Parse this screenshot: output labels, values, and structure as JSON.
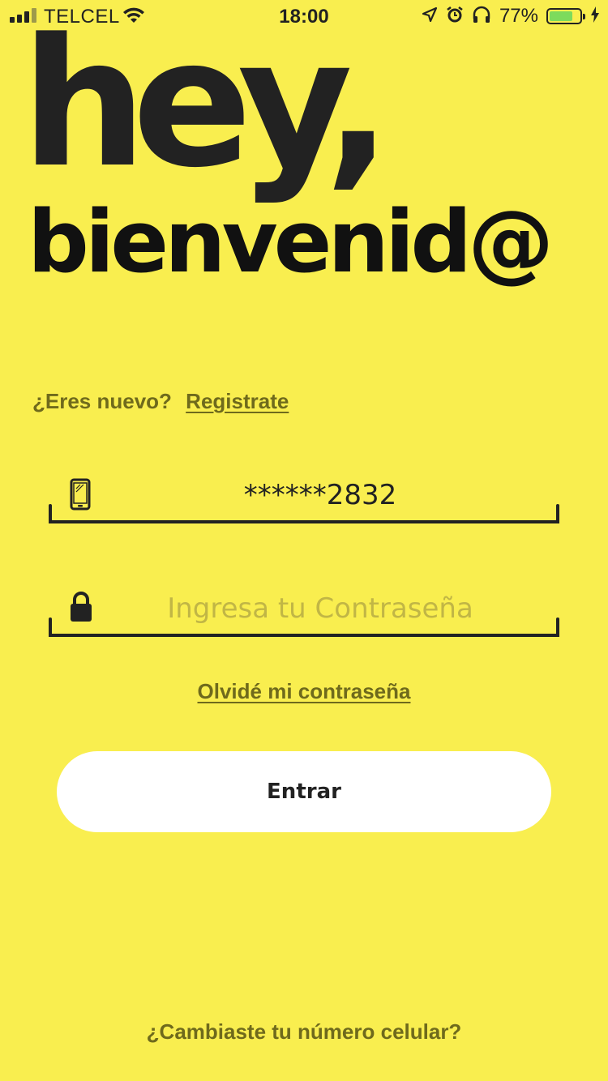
{
  "status_bar": {
    "carrier": "TELCEL",
    "time": "18:00",
    "battery_percent": "77%",
    "battery_level": 0.77,
    "signal_bars": 4,
    "signal_active": 3,
    "icons": [
      "signal-icon",
      "wifi-icon",
      "location-arrow-icon",
      "alarm-icon",
      "headphones-icon",
      "battery-icon",
      "charging-bolt-icon"
    ]
  },
  "headline": {
    "line1": "hey,",
    "line2": "bienvenid@"
  },
  "register": {
    "prompt": "¿Eres nuevo?",
    "link": "Registrate"
  },
  "phone_field": {
    "value": "******2832",
    "icon": "mobile-phone-icon"
  },
  "password_field": {
    "value": "",
    "placeholder": "Ingresa tu Contraseña",
    "icon": "lock-icon"
  },
  "forgot_password": "Olvidé mi contraseña",
  "submit_button": "Entrar",
  "change_number": "¿Cambiaste tu número celular?",
  "colors": {
    "background": "#f9ee4f",
    "text_dark": "#222222",
    "link_olive": "#6f6a1c",
    "placeholder": "#c1b645",
    "button_bg": "#ffffff",
    "battery_fill": "#7ddb5c"
  }
}
